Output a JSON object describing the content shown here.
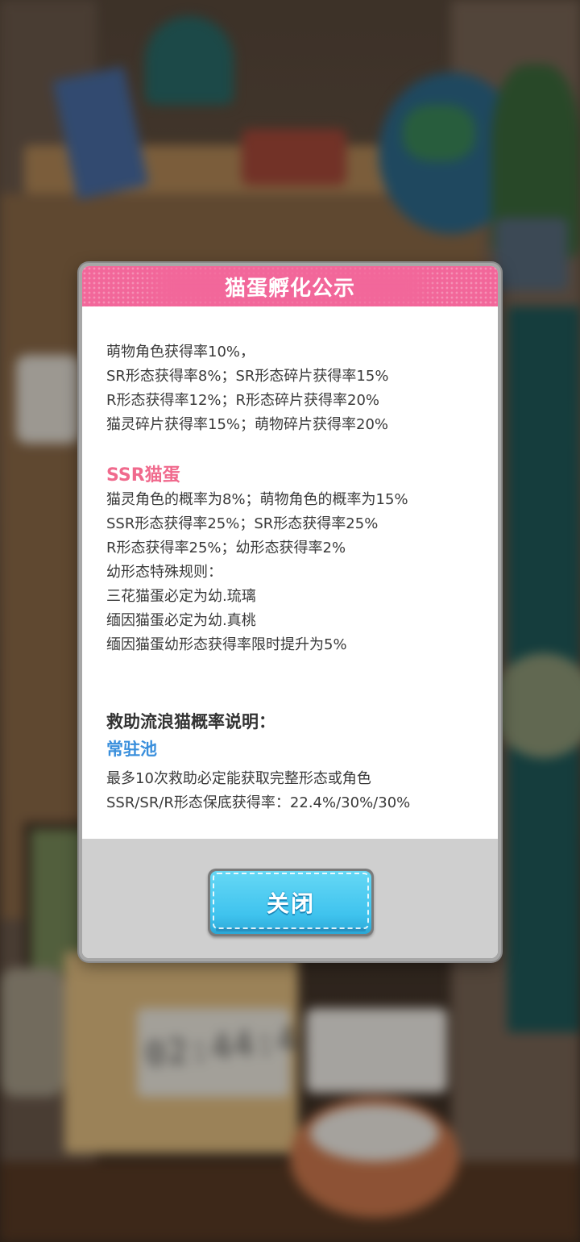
{
  "background": {
    "timer": "02:44:41"
  },
  "dialog": {
    "title": "猫蛋孵化公示",
    "intro_lines": [
      "萌物角色获得率10%，",
      "SR形态获得率8%；SR形态碎片获得率15%",
      "R形态获得率12%；R形态碎片获得率20%",
      "猫灵碎片获得率15%；萌物碎片获得率20%"
    ],
    "ssr_section": {
      "heading": "SSR猫蛋",
      "lines": [
        "猫灵角色的概率为8%；萌物角色的概率为15%",
        "SSR形态获得率25%；SR形态获得率25%",
        "R形态获得率25%；幼形态获得率2%",
        "幼形态特殊规则：",
        "三花猫蛋必定为幼.琉璃",
        "缅因猫蛋必定为幼.真桃",
        "缅因猫蛋幼形态获得率限时提升为5%"
      ]
    },
    "rescue_section": {
      "heading": "救助流浪猫概率说明：",
      "pool_name": "常驻池",
      "lines": [
        "最多10次救助必定能获取完整形态或角色",
        "SSR/SR/R形态保底获得率：22.4%/30%/30%"
      ]
    },
    "close_label": "关闭"
  },
  "colors": {
    "header_pink": "#f2679a",
    "ssr_pink": "#f06a8d",
    "pool_blue": "#3a8fdc",
    "button_blue": "#3fc3ee"
  }
}
